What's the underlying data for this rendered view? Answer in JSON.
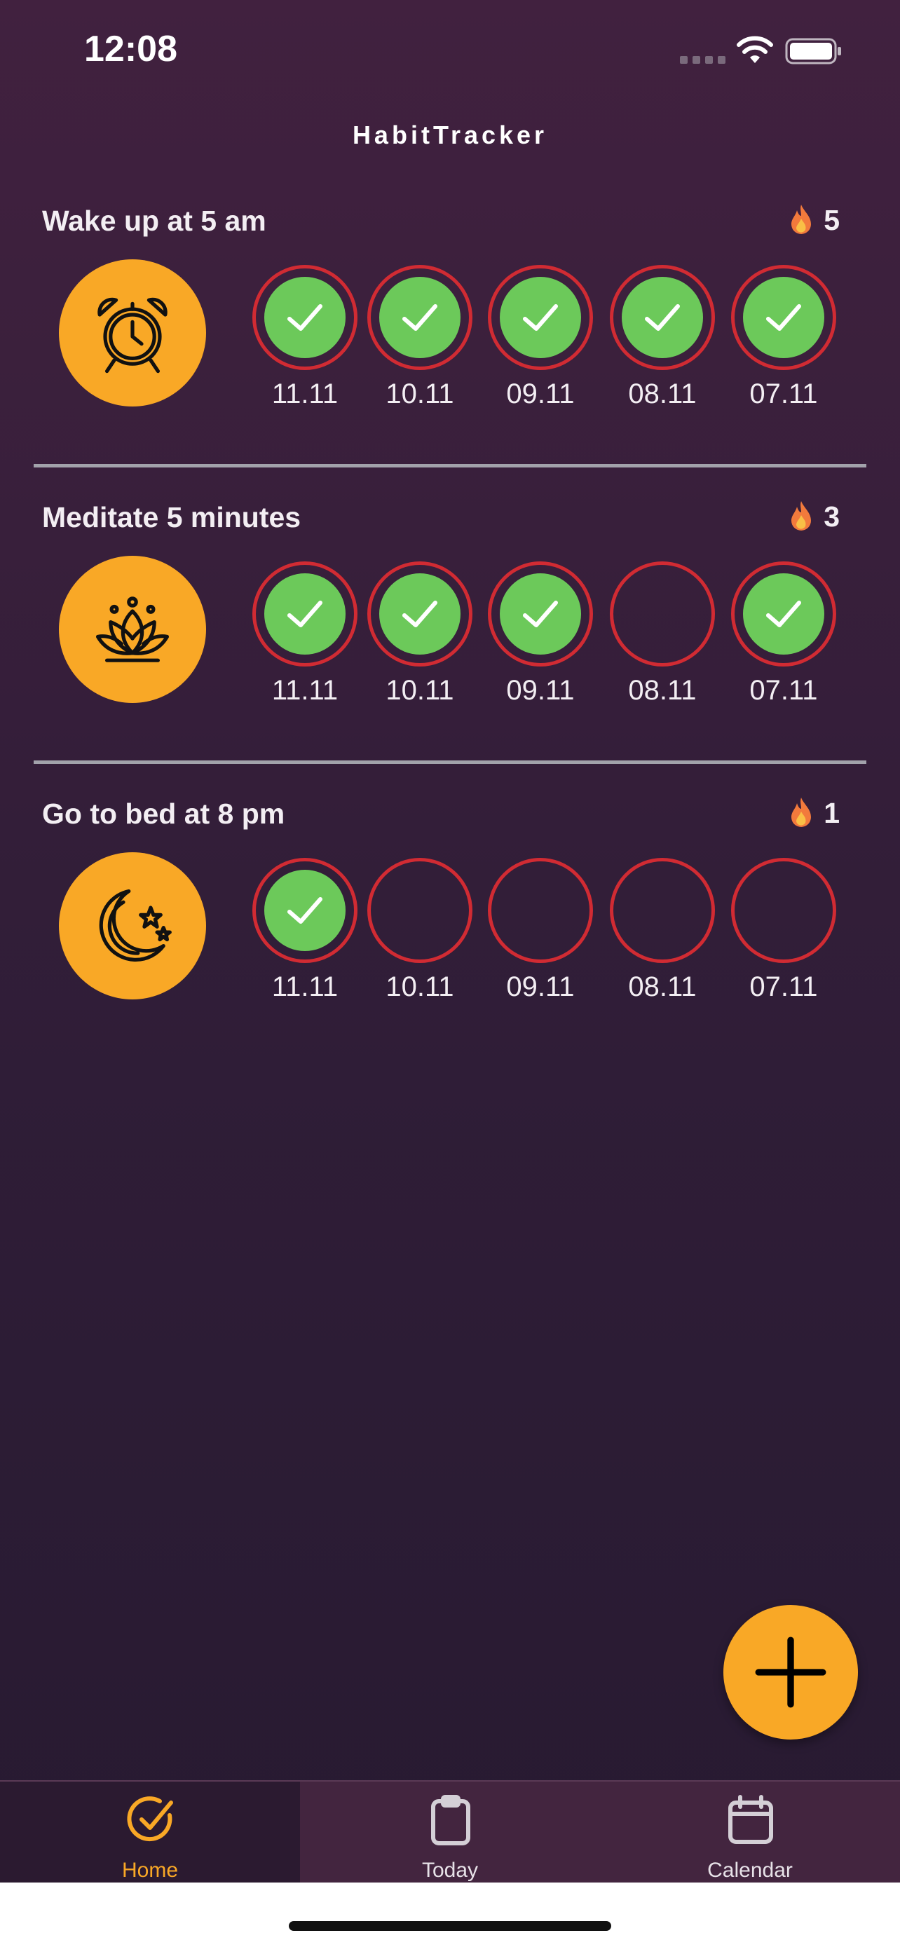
{
  "status_bar": {
    "time": "12:08"
  },
  "app": {
    "title": "HabitTracker"
  },
  "habits": [
    {
      "title": "Wake up at 5 am",
      "icon": "alarm-clock-icon",
      "streak": "5",
      "days": [
        {
          "label": "11.11",
          "done": true
        },
        {
          "label": "10.11",
          "done": true
        },
        {
          "label": "09.11",
          "done": true
        },
        {
          "label": "08.11",
          "done": true
        },
        {
          "label": "07.11",
          "done": true
        }
      ]
    },
    {
      "title": "Meditate 5 minutes",
      "icon": "lotus-icon",
      "streak": "3",
      "days": [
        {
          "label": "11.11",
          "done": true
        },
        {
          "label": "10.11",
          "done": true
        },
        {
          "label": "09.11",
          "done": true
        },
        {
          "label": "08.11",
          "done": false
        },
        {
          "label": "07.11",
          "done": true
        }
      ]
    },
    {
      "title": "Go to bed at 8 pm",
      "icon": "moon-stars-icon",
      "streak": "1",
      "days": [
        {
          "label": "11.11",
          "done": true
        },
        {
          "label": "10.11",
          "done": false
        },
        {
          "label": "09.11",
          "done": false
        },
        {
          "label": "08.11",
          "done": false
        },
        {
          "label": "07.11",
          "done": false
        }
      ]
    }
  ],
  "fab": {
    "icon": "plus-icon"
  },
  "tabbar": {
    "tabs": [
      {
        "label": "Home",
        "icon": "check-circle-icon",
        "active": true
      },
      {
        "label": "Today",
        "icon": "clipboard-icon",
        "active": false
      },
      {
        "label": "Calendar",
        "icon": "calendar-icon",
        "active": false
      }
    ]
  },
  "colors": {
    "accent": "#f9a826",
    "done": "#6cc95a",
    "ring": "#d12b33",
    "background": "#3a2038"
  }
}
